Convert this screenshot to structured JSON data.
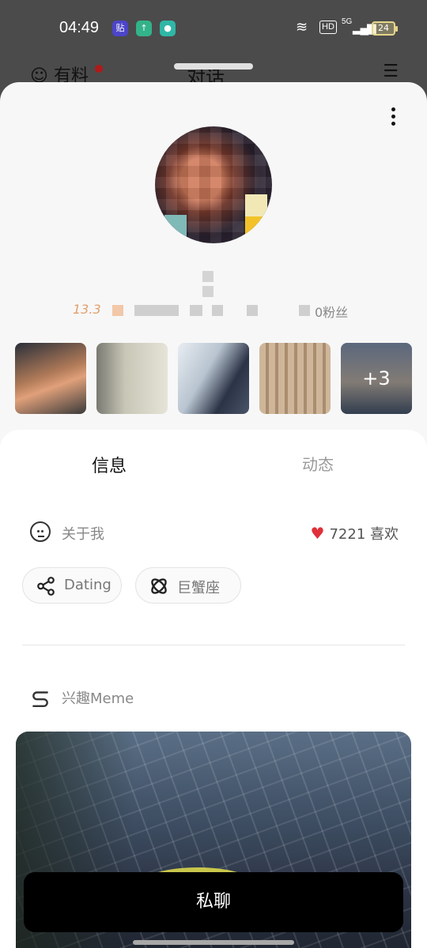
{
  "status_bar": {
    "time": "04:49",
    "app_icons": [
      "贴",
      "↑",
      "●"
    ],
    "hd": "HD",
    "network": "5G",
    "battery": "24"
  },
  "underlying_header": {
    "left_label": "有料",
    "title": "对话"
  },
  "profile": {
    "age_text": "13.3",
    "fans_text": "0粉丝",
    "photos_more": "+3"
  },
  "tabs": {
    "info": "信息",
    "dynamics": "动态"
  },
  "about": {
    "label": "关于我",
    "likes_text": "7221 喜欢"
  },
  "chips": [
    {
      "label": "Dating",
      "icon": "share-icon"
    },
    {
      "label": "巨蟹座",
      "icon": "cancer-zodiac-icon"
    }
  ],
  "interest": {
    "label": "兴趣Meme",
    "icon": "meme-logo-icon"
  },
  "action": {
    "chat_label": "私聊"
  },
  "colors": {
    "accent_age": "#e2a06e",
    "heart": "#e0303a",
    "button_bg": "#000000"
  }
}
